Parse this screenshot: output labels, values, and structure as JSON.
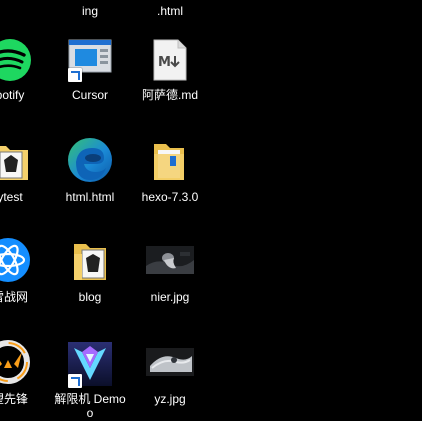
{
  "desktop": {
    "row0": {
      "col1_label": "ing",
      "col2_label": ".html"
    },
    "row1": {
      "col0_label": "potify",
      "col1_label": "Cursor",
      "col2_label": "阿萨德.md"
    },
    "row2": {
      "col0_label": "ytest",
      "col1_label": "html.html",
      "col2_label": "hexo-7.3.0"
    },
    "row3": {
      "col0_label": "雪战网",
      "col1_label": "blog",
      "col2_label": "nier.jpg"
    },
    "row4": {
      "col0_label": "望先锋",
      "col1_label": "解限机 Demo",
      "col1_label_line2": "o",
      "col2_label": "yz.jpg"
    },
    "icons": {
      "spotify": "spotify-icon",
      "cursor": "cursor-app-icon",
      "markdown": "markdown-file-icon",
      "folder_app": "folder-app-icon",
      "edge": "edge-html-icon",
      "folder": "folder-icon",
      "battlenet": "battlenet-icon",
      "image": "image-thumbnail-icon",
      "overwatch": "overwatch-icon",
      "mecha": "mecha-break-icon"
    },
    "colors": {
      "spotify": "#1ed760",
      "edge_blue": "#1b8ad6",
      "edge_green": "#35c274",
      "folder": "#f4d06b",
      "battlenet": "#148eff",
      "overwatch": "#f99e1a"
    }
  }
}
